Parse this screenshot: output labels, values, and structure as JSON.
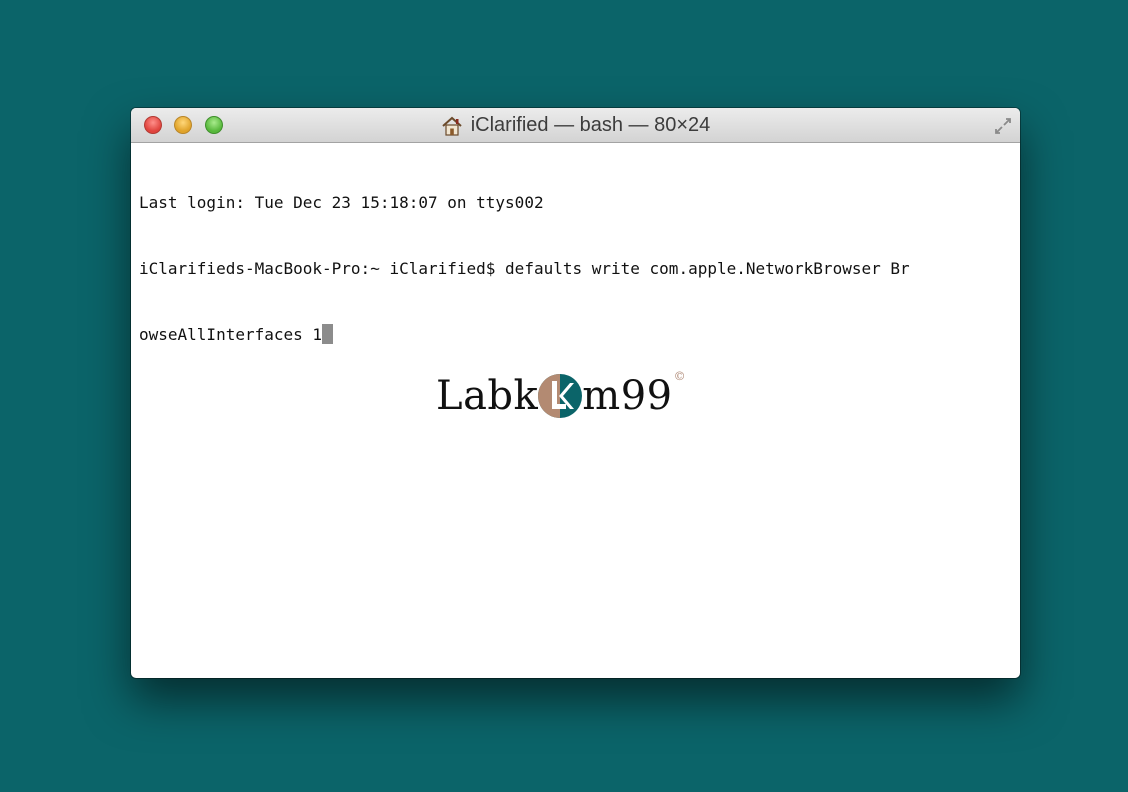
{
  "window": {
    "title": "iClarified — bash — 80×24"
  },
  "terminal": {
    "lines": [
      "Last login: Tue Dec 23 15:18:07 on ttys002",
      "iClarifieds-MacBook-Pro:~ iClarified$ defaults write com.apple.NetworkBrowser Br",
      "owseAllInterfaces 1"
    ]
  },
  "watermark": {
    "left": "Labk",
    "right": "m99",
    "mark": "©"
  },
  "colors": {
    "desktop": "#0b6469",
    "emblem_teal": "#0b6469",
    "emblem_tan": "#b38a72"
  },
  "icons": {
    "title": "home-icon",
    "fullscreen": "fullscreen-icon"
  }
}
